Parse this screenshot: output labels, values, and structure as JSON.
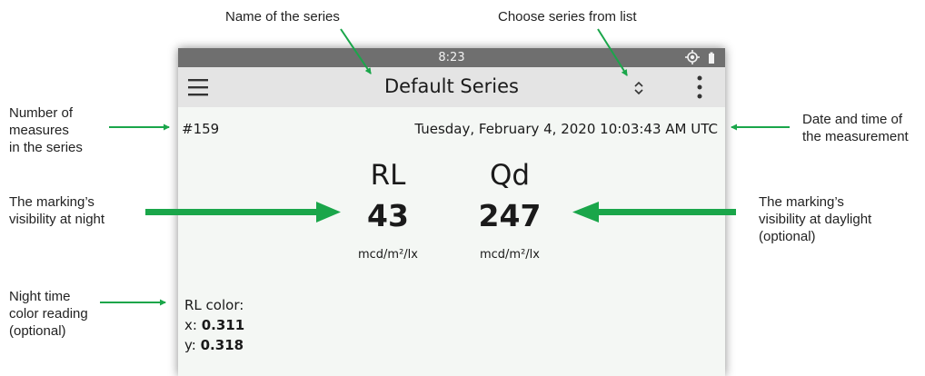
{
  "callouts": {
    "series_name": "Name of the series",
    "choose_series": "Choose series from list",
    "number_of_measures": [
      "Number of",
      "measures",
      "in the series"
    ],
    "date_time": [
      "Date and time of",
      "the measurement"
    ],
    "night_visibility": [
      "The marking’s",
      "visibility at night"
    ],
    "day_visibility": [
      "The marking’s",
      "visibility at daylight",
      "(optional)"
    ],
    "night_color": [
      "Night time",
      "color reading",
      "(optional)"
    ]
  },
  "status_bar": {
    "time": "8:23",
    "icons": [
      "location-icon",
      "battery-icon"
    ]
  },
  "app_bar": {
    "menu_icon": "menu-icon",
    "title": "Default Series",
    "series_selector_icon": "unfold-icon",
    "overflow_icon": "more-vert-icon"
  },
  "measurement": {
    "count": "#159",
    "datetime": "Tuesday, February 4, 2020 10:03:43 AM UTC",
    "rl": {
      "label": "RL",
      "value": "43",
      "unit": "mcd/m²/lx"
    },
    "qd": {
      "label": "Qd",
      "value": "247",
      "unit": "mcd/m²/lx"
    },
    "rl_color": {
      "label": "RL color:",
      "x_label": "x:",
      "x_value": "0.311",
      "y_label": "y:",
      "y_value": "0.318"
    }
  },
  "colors": {
    "arrow": "#1aa64a",
    "status_bar": "#6f6f6f",
    "app_bar": "#e4e4e4",
    "screen": "#f4f7f4"
  }
}
